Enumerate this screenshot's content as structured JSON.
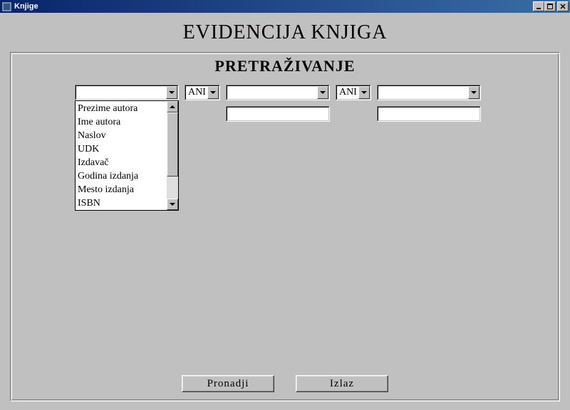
{
  "window": {
    "title": "Knjige"
  },
  "page": {
    "title": "EVIDENCIJA KNJIGA",
    "subtitle": "PRETRAŽIVANJE"
  },
  "form": {
    "field1": "",
    "op1": "AND",
    "field2": "",
    "op2": "AND",
    "field3": "",
    "value1": "",
    "value2": "",
    "value3": "",
    "field_options": [
      "Prezime autora",
      "Ime autora",
      "Naslov",
      "UDK",
      "Izdavač",
      "Godina izdanja",
      "Mesto izdanja",
      "ISBN"
    ]
  },
  "buttons": {
    "search": "Pronadji",
    "exit": "Izlaz"
  }
}
